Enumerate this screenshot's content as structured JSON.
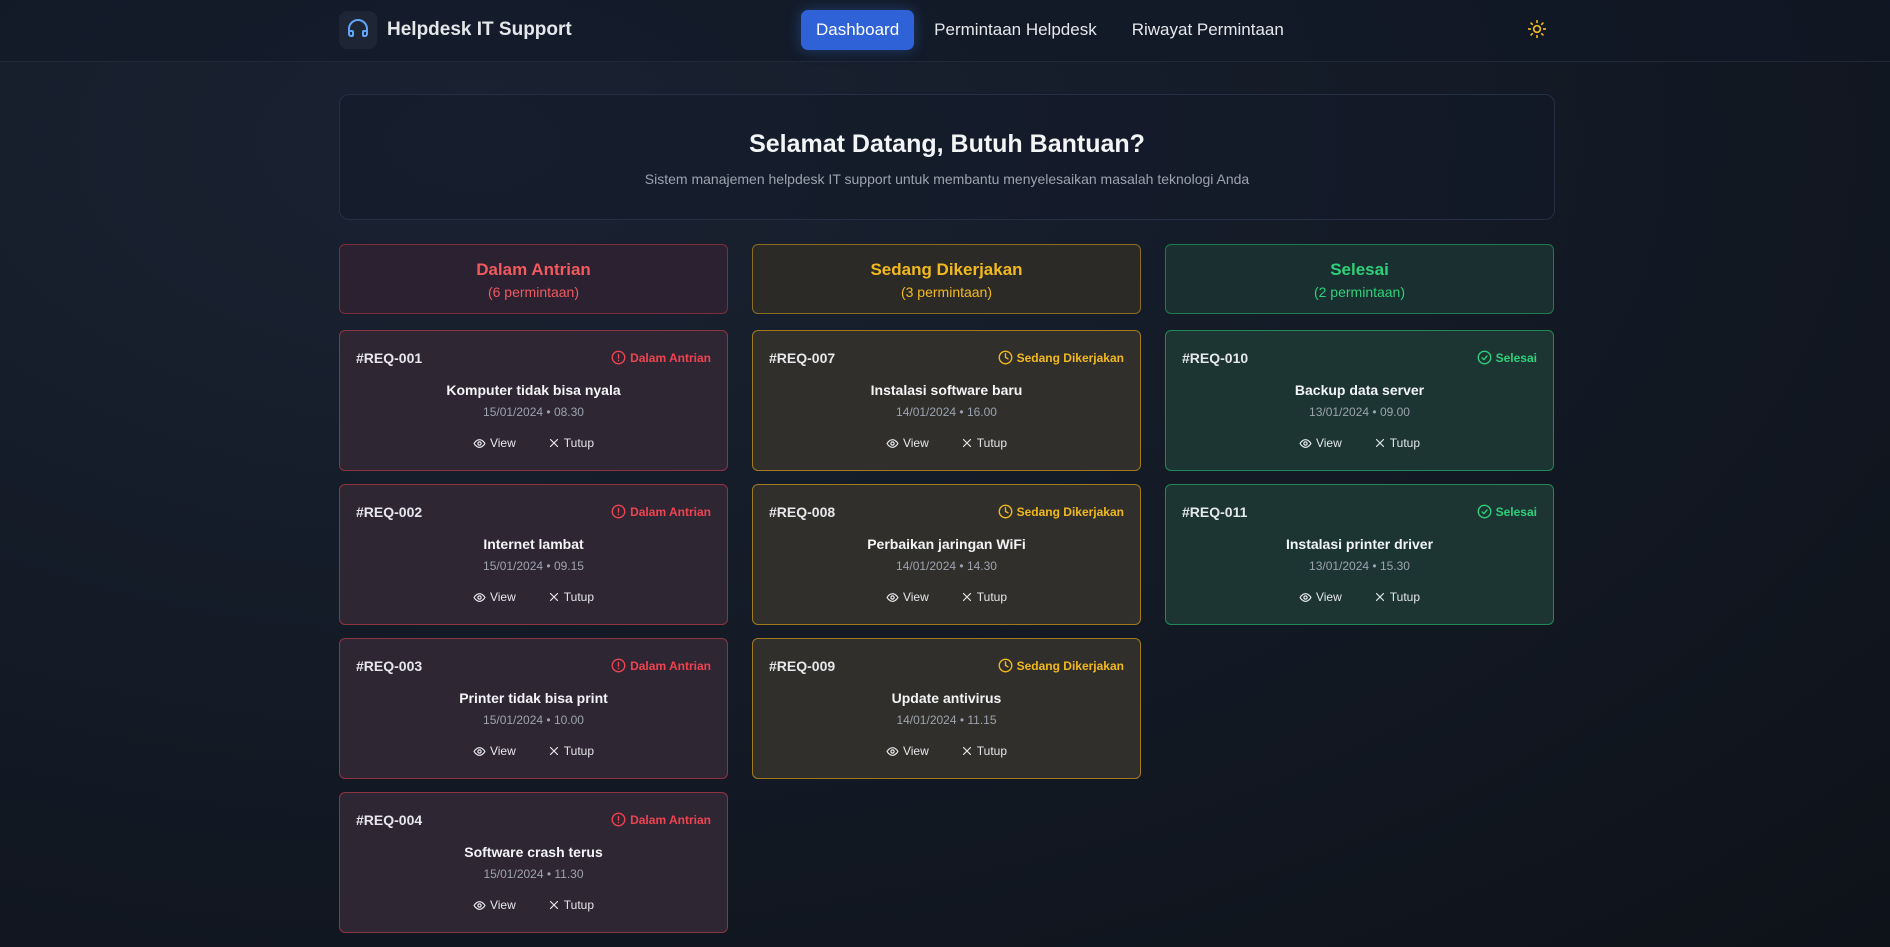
{
  "header": {
    "brand": "Helpdesk IT Support",
    "nav": [
      "Dashboard",
      "Permintaan Helpdesk",
      "Riwayat Permintaan"
    ],
    "active_nav": "Dashboard"
  },
  "hero": {
    "title": "Selamat Datang, Butuh Bantuan?",
    "subtitle": "Sistem manajemen helpdesk IT support untuk membantu menyelesaikan masalah teknologi Anda"
  },
  "actions": {
    "view": "View",
    "close": "Tutup"
  },
  "columns": [
    {
      "title": "Dalam Antrian",
      "count": "(6 permintaan)",
      "color": "#f0595e",
      "cards": [
        {
          "id": "#REQ-001",
          "status": "Dalam Antrian",
          "title": "Komputer tidak bisa nyala",
          "date": "15/01/2024 • 08.30"
        },
        {
          "id": "#REQ-002",
          "status": "Dalam Antrian",
          "title": "Internet lambat",
          "date": "15/01/2024 • 09.15"
        },
        {
          "id": "#REQ-003",
          "status": "Dalam Antrian",
          "title": "Printer tidak bisa print",
          "date": "15/01/2024 • 10.00"
        },
        {
          "id": "#REQ-004",
          "status": "Dalam Antrian",
          "title": "Software crash terus",
          "date": "15/01/2024 • 11.30"
        }
      ]
    },
    {
      "title": "Sedang Dikerjakan",
      "count": "(3 permintaan)",
      "color": "#f2b91f",
      "cards": [
        {
          "id": "#REQ-007",
          "status": "Sedang Dikerjakan",
          "title": "Instalasi software baru",
          "date": "14/01/2024 • 16.00"
        },
        {
          "id": "#REQ-008",
          "status": "Sedang Dikerjakan",
          "title": "Perbaikan jaringan WiFi",
          "date": "14/01/2024 • 14.30"
        },
        {
          "id": "#REQ-009",
          "status": "Sedang Dikerjakan",
          "title": "Update antivirus",
          "date": "14/01/2024 • 11.15"
        }
      ]
    },
    {
      "title": "Selesai",
      "count": "(2 permintaan)",
      "color": "#2ed17a",
      "cards": [
        {
          "id": "#REQ-010",
          "status": "Selesai",
          "title": "Backup data server",
          "date": "13/01/2024 • 09.00"
        },
        {
          "id": "#REQ-011",
          "status": "Selesai",
          "title": "Instalasi printer driver",
          "date": "13/01/2024 • 15.30"
        }
      ]
    }
  ]
}
